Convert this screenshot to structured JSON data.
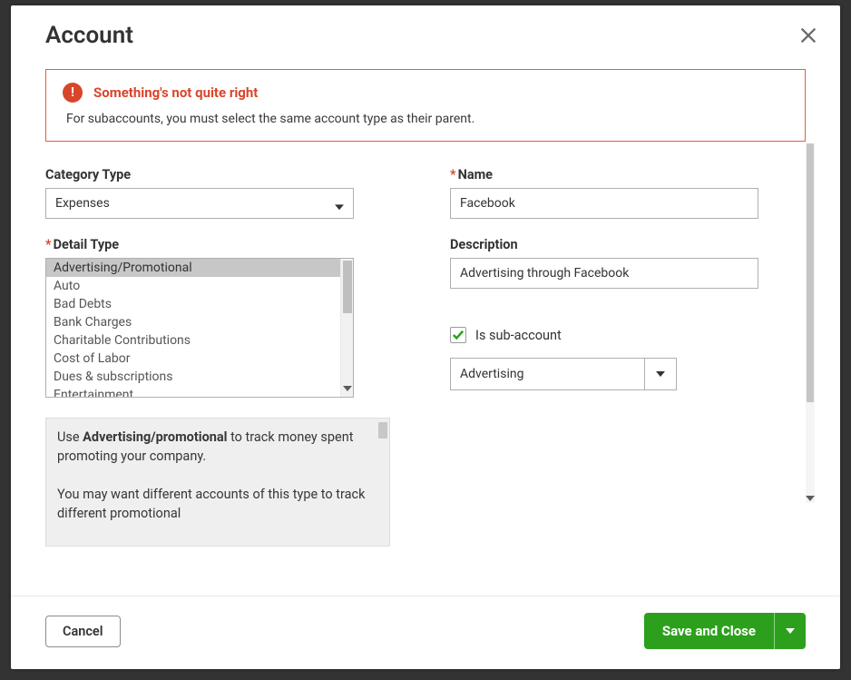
{
  "modal": {
    "title": "Account",
    "close_label": "Close"
  },
  "alert": {
    "title": "Something's not quite right",
    "message": "For subaccounts, you must select the same account type as their parent."
  },
  "left": {
    "category_label": "Category Type",
    "category_value": "Expenses",
    "detail_label": "Detail Type",
    "detail_options": [
      "Advertising/Promotional",
      "Auto",
      "Bad Debts",
      "Bank Charges",
      "Charitable Contributions",
      "Cost of Labor",
      "Dues & subscriptions",
      "Entertainment"
    ],
    "detail_selected_index": 0,
    "help_html_prefix": "Use ",
    "help_bold": "Advertising/promotional",
    "help_html_mid": " to track money spent promoting your company.",
    "help_para2": "You may want different accounts of this type to track different promotional"
  },
  "right": {
    "name_label": "Name",
    "name_value": "Facebook",
    "desc_label": "Description",
    "desc_value": "Advertising through Facebook",
    "sub_label": "Is sub-account",
    "sub_checked": true,
    "parent_value": "Advertising"
  },
  "footer": {
    "cancel": "Cancel",
    "save": "Save and Close"
  }
}
